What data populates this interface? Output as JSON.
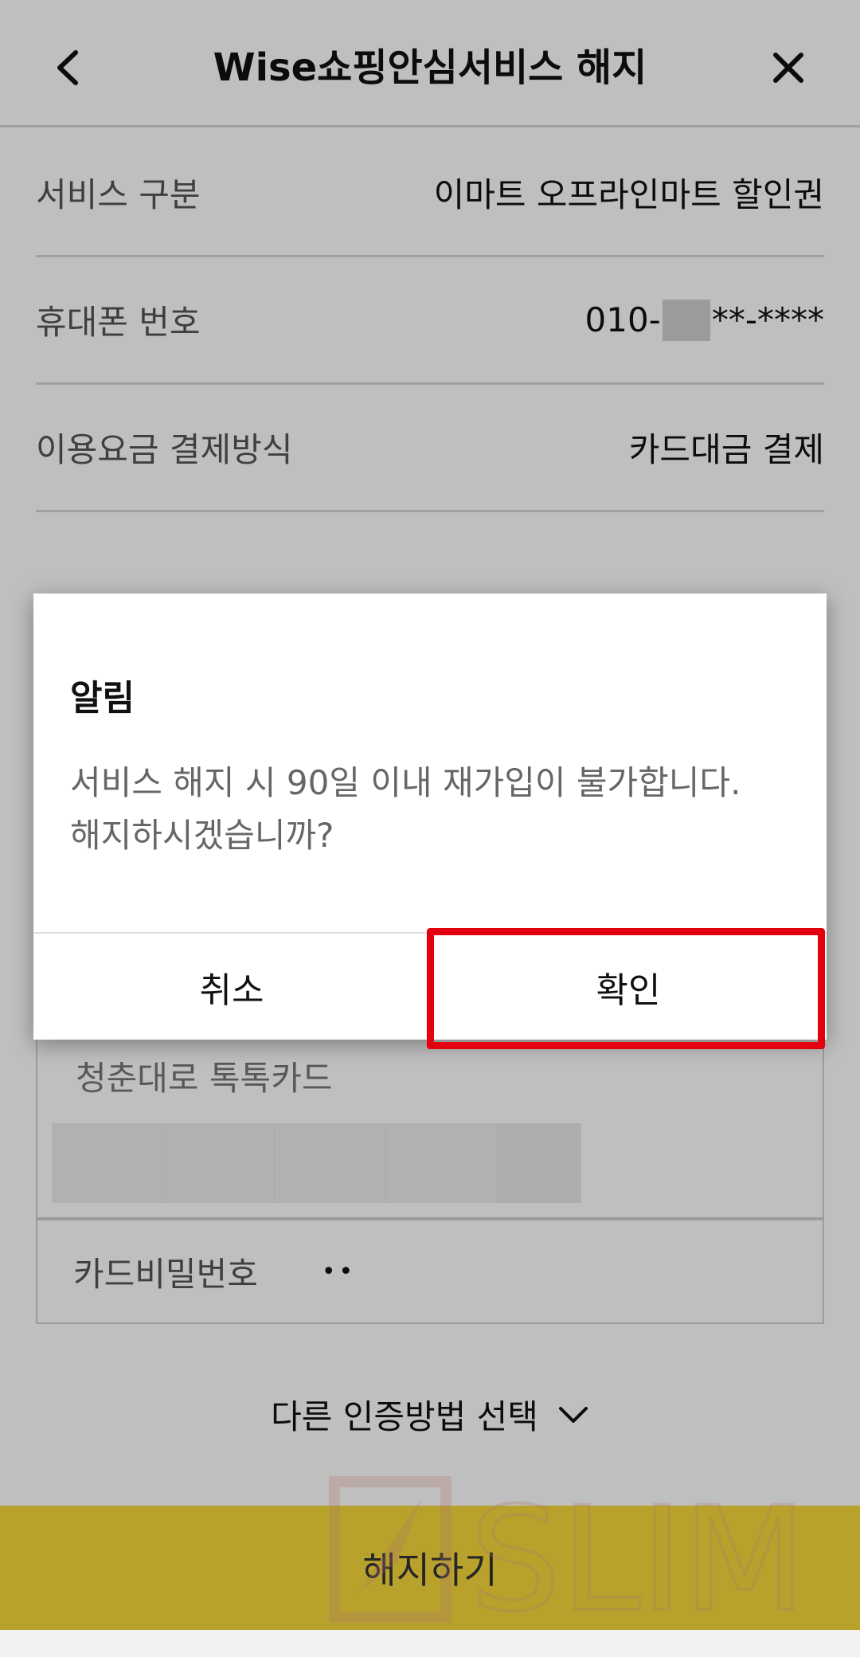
{
  "header": {
    "title": "Wise쇼핑안심서비스 해지",
    "back_icon": "chevron-left-icon",
    "close_icon": "close-icon"
  },
  "info": {
    "service_label": "서비스 구분",
    "service_value": "이마트 오프라인마트 할인권",
    "phone_label": "휴대폰 번호",
    "phone_prefix": "010-",
    "phone_suffix": "**-****",
    "payment_label": "이용요금 결제방식",
    "payment_value": "카드대금 결제"
  },
  "card": {
    "name": "청춘대로 톡톡카드",
    "password_label": "카드비밀번호",
    "password_value": "••"
  },
  "other_auth": {
    "label": "다른 인증방법 선택",
    "icon": "chevron-down-icon"
  },
  "submit": {
    "label": "해지하기"
  },
  "dialog": {
    "title": "알림",
    "message": "서비스 해지 시 90일 이내 재가입이 불가합니다.\n해지하시겠습니까?",
    "cancel_label": "취소",
    "confirm_label": "확인",
    "highlight_color": "#e3000f"
  },
  "colors": {
    "accent": "#f7d93b"
  },
  "watermark": {
    "text": "SLIM"
  }
}
